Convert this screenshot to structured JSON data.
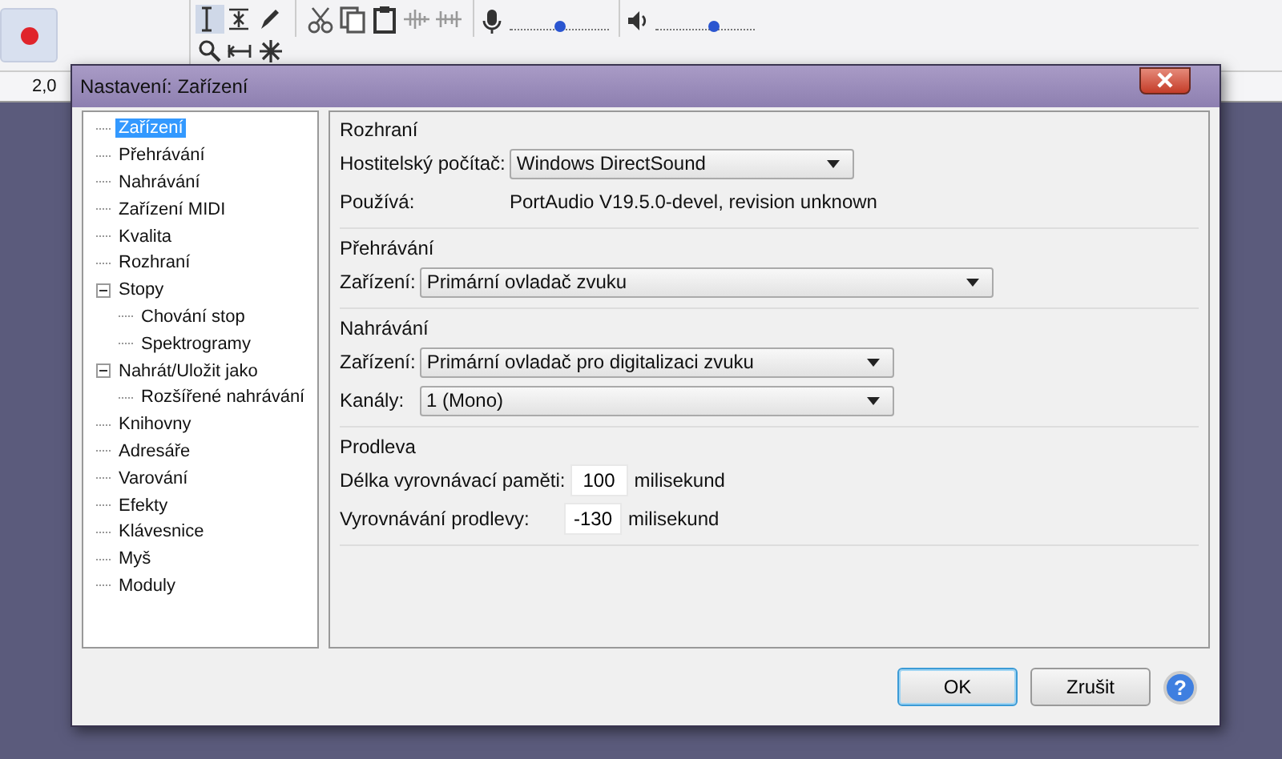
{
  "toolbar": {
    "mic": {
      "level": 0.5
    },
    "speaker": {
      "level": 0.58
    }
  },
  "ruler": {
    "label": "2,0"
  },
  "dialog": {
    "title": "Nastavení: Zařízení",
    "tree": [
      {
        "label": "Zařízení",
        "selected": true
      },
      {
        "label": "Přehrávání",
        "selected": false
      },
      {
        "label": "Nahrávání",
        "selected": false
      },
      {
        "label": "Zařízení MIDI",
        "selected": false
      },
      {
        "label": "Kvalita",
        "selected": false
      },
      {
        "label": "Rozhraní",
        "selected": false
      },
      {
        "label": "Stopy",
        "selected": false,
        "expanded": true,
        "children": [
          {
            "label": "Chování stop",
            "selected": false
          },
          {
            "label": "Spektrogramy",
            "selected": false
          }
        ]
      },
      {
        "label": "Nahrát/Uložit jako",
        "selected": false,
        "expanded": true,
        "children": [
          {
            "label": "Rozšířené nahrávání",
            "selected": false
          }
        ]
      },
      {
        "label": "Knihovny",
        "selected": false
      },
      {
        "label": "Adresáře",
        "selected": false
      },
      {
        "label": "Varování",
        "selected": false
      },
      {
        "label": "Efekty",
        "selected": false
      },
      {
        "label": "Klávesnice",
        "selected": false
      },
      {
        "label": "Myš",
        "selected": false
      },
      {
        "label": "Moduly",
        "selected": false
      }
    ],
    "groups": [
      {
        "title": "Rozhraní",
        "rows": [
          {
            "kind": "select",
            "label": "Hostitelský počítač:",
            "value": "Windows DirectSound"
          },
          {
            "kind": "info",
            "label": "Používá:",
            "value": "PortAudio V19.5.0-devel, revision unknown"
          }
        ]
      },
      {
        "title": "Přehrávání",
        "rows": [
          {
            "kind": "select",
            "label": "Zařízení:",
            "value": "Primární ovladač zvuku"
          }
        ]
      },
      {
        "title": "Nahrávání",
        "rows": [
          {
            "kind": "select",
            "label": "Zařízení:",
            "value": "Primární ovladač pro digitalizaci zvuku"
          },
          {
            "kind": "select",
            "label": "Kanály:",
            "value": "1 (Mono)"
          }
        ]
      },
      {
        "title": "Prodleva",
        "rows": [
          {
            "kind": "number",
            "label": "Délka vyrovnávací paměti:",
            "value": "100",
            "unit": "milisekund"
          },
          {
            "kind": "number",
            "label": "Vyrovnávání prodlevy:",
            "value": "-130",
            "unit": "milisekund"
          }
        ]
      }
    ],
    "buttons": [
      {
        "label": "OK",
        "default": true
      },
      {
        "label": "Zrušit",
        "default": false
      }
    ],
    "help": "?"
  }
}
